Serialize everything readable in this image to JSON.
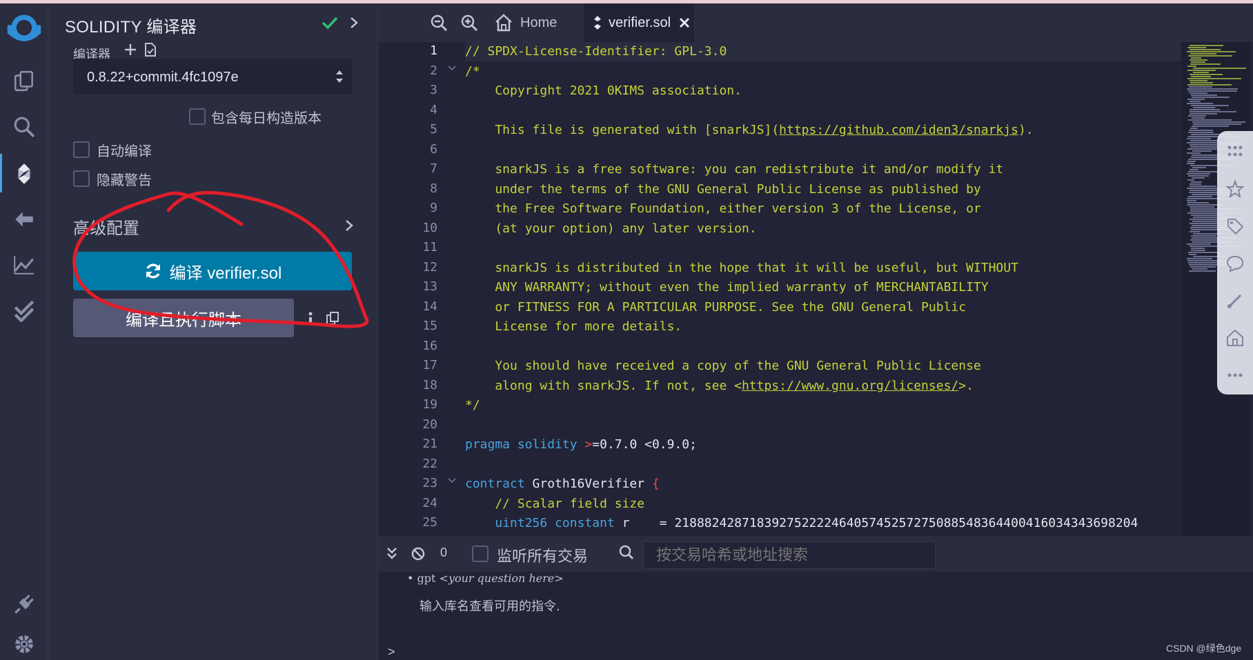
{
  "panel": {
    "title": "SOLIDITY 编译器",
    "compiler_label": "编译器",
    "compiler_version": "0.8.22+commit.4fc1097e",
    "include_nightly_label": "包含每日构造版本",
    "auto_compile_label": "自动编译",
    "hide_warnings_label": "隐藏警告",
    "advanced_config_label": "高级配置",
    "compile_button_label": "编译 verifier.sol",
    "compile_run_button_label": "编译且执行脚本"
  },
  "tabs": {
    "home_label": "Home",
    "active_label": "verifier.sol"
  },
  "editor": {
    "line_numbers": [
      "1",
      "2",
      "3",
      "4",
      "5",
      "6",
      "7",
      "8",
      "9",
      "10",
      "11",
      "12",
      "13",
      "14",
      "15",
      "16",
      "17",
      "18",
      "19",
      "20",
      "21",
      "22",
      "23",
      "24",
      "25"
    ],
    "lines": {
      "l1": "// SPDX-License-Identifier: GPL-3.0",
      "l2": "/*",
      "l3": "    Copyright 2021 0KIMS association.",
      "l5a": "    This file is generated with [snarkJS](",
      "l5url": "https://github.com/iden3/snarkjs",
      "l5b": ").",
      "l7": "    snarkJS is a free software: you can redistribute it and/or modify it",
      "l8": "    under the terms of the GNU General Public License as published by",
      "l9": "    the Free Software Foundation, either version 3 of the License, or",
      "l10": "    (at your option) any later version.",
      "l12": "    snarkJS is distributed in the hope that it will be useful, but WITHOUT",
      "l13": "    ANY WARRANTY; without even the implied warranty of MERCHANTABILITY",
      "l14": "    or FITNESS FOR A PARTICULAR PURPOSE. See the GNU General Public",
      "l15": "    License for more details.",
      "l17": "    You should have received a copy of the GNU General Public License",
      "l18a": "    along with snarkJS. If not, see <",
      "l18url": "https://www.gnu.org/licenses/",
      "l18b": ">.",
      "l19": "*/",
      "l21kw1": "pragma",
      "l21kw2": "solidity",
      "l21op": ">",
      "l21rest": "=0.7.0 <0.9.0;",
      "l23kw": "contract",
      "l23name": " Groth16Verifier ",
      "l23brace": "{",
      "l24": "    // Scalar field size",
      "l25kw1": "uint256",
      "l25kw2": "constant",
      "l25rest": " r    = 21888242871839275222246405745257275088548364400416034343698204"
    }
  },
  "terminal": {
    "count": "0",
    "listen_label": "监听所有交易",
    "search_placeholder": "按交易哈希或地址搜索",
    "gpt_cmd": "gpt",
    "gpt_arg": "<your question here>",
    "hint": "输入库名查看可用的指令.",
    "prompt": ">"
  },
  "watermark": "CSDN @绿色dge",
  "colors": {
    "accent": "#007aa6",
    "comment": "#c6d33a",
    "keyword": "#4aa3df",
    "operator": "#e0504f",
    "success": "#2fbf71",
    "annotation": "#e01e2a"
  },
  "icons": [
    "remix-logo-icon",
    "file-explorer-icon",
    "search-icon",
    "solidity-compiler-icon",
    "deploy-run-icon",
    "analysis-icon",
    "verified-icon",
    "plugin-manager-icon",
    "settings-icon",
    "zoom-out-icon",
    "zoom-in-icon",
    "home-icon",
    "close-icon"
  ]
}
